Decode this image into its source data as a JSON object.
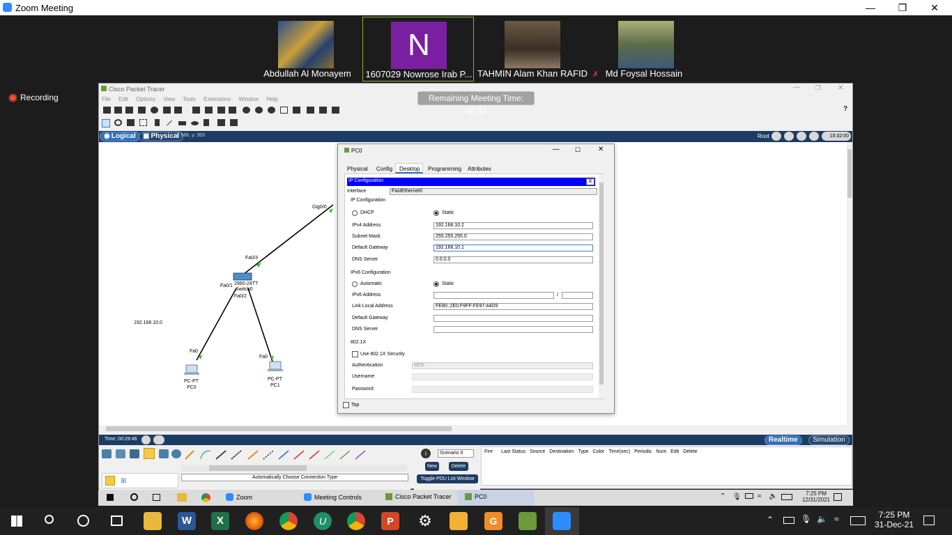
{
  "zoom": {
    "title": "Zoom Meeting",
    "recording": "Recording",
    "remaining": "Remaining Meeting Time: 08:35",
    "participants": [
      {
        "name": "Abdullah Al Monayem"
      },
      {
        "name": "1607029 Nowrose Irab P...",
        "initial": "N"
      },
      {
        "name": "TAHMIN Alam Khan RAFID"
      },
      {
        "name": "Md Foysal Hossain"
      }
    ]
  },
  "pt": {
    "title": "Cisco Packet Tracer",
    "menu": [
      "File",
      "Edit",
      "Options",
      "View",
      "Tools",
      "Extensions",
      "Window",
      "Help"
    ],
    "logical": "Logical",
    "physical": "Physical",
    "coords": "x: 566, y: 353",
    "root": "Root",
    "clock": "15:32:00",
    "time": "Time: 00:29:46",
    "realtime": "Realtime",
    "simulation": "Simulation",
    "topology": {
      "gig": "Gig0/0",
      "fa03": "Fa0/3",
      "fa01": "Fa0/1",
      "fa02": "Fa0/2",
      "switch_model": "2960-24TT",
      "switch_name": "Switch0",
      "network": "192.168.10.0",
      "fa0_a": "Fa0",
      "fa0_b": "Fa0",
      "pc0_type": "PC-PT",
      "pc0_name": "PC0",
      "pc1_type": "PC-PT",
      "pc1_name": "PC1"
    },
    "conn_type": "Automatically Choose Connection Type",
    "scenario": "Scenario 0",
    "new": "New",
    "delete": "Delete",
    "toggle_pdu": "Toggle PDU List Window",
    "pdu_cols": [
      "Fire",
      "Last Status",
      "Source",
      "Destination",
      "Type",
      "Color",
      "Time(sec)",
      "Periodic",
      "Num",
      "Edit",
      "Delete"
    ]
  },
  "dialog": {
    "title": "PC0",
    "tabs": [
      "Physical",
      "Config",
      "Desktop",
      "Programming",
      "Attributes"
    ],
    "active_tab": "Desktop",
    "header": "IP Configuration",
    "close_x": "X",
    "interface_label": "Interface",
    "interface_value": "FastEthernet0",
    "ipcfg_section": "IP Configuration",
    "dhcp": "DHCP",
    "static": "Static",
    "ipv4_label": "IPv4 Address",
    "ipv4": "192.168.10.2",
    "mask_label": "Subnet Mask",
    "mask": "255.255.255.0",
    "gw_label": "Default Gateway",
    "gw": "192.168.10.1",
    "dns_label": "DNS Server",
    "dns": "0.0.0.0",
    "ipv6_section": "IPv6 Configuration",
    "automatic": "Automatic",
    "static6": "Static",
    "ipv6_label": "IPv6 Address",
    "slash": "/",
    "lla_label": "Link Local Address",
    "lla": "FE80::2E0:F9FF:FE97:44D9",
    "gw6_label": "Default Gateway",
    "dns6_label": "DNS Server",
    "dot1x_section": "802.1X",
    "use_dot1x": "Use 802.1X Security",
    "auth_label": "Authentication",
    "auth": "MD5",
    "user_label": "Username",
    "pass_label": "Password",
    "top": "Top"
  },
  "inner_taskbar": {
    "zoom": "Zoom",
    "meeting_controls": "Meeting Controls",
    "cpt": "Cisco Packet Tracer",
    "pc0": "PC0",
    "time": "7:25 PM",
    "date": "12/31/2021"
  },
  "taskbar": {
    "time": "7:25 PM",
    "date": "31-Dec-21"
  }
}
